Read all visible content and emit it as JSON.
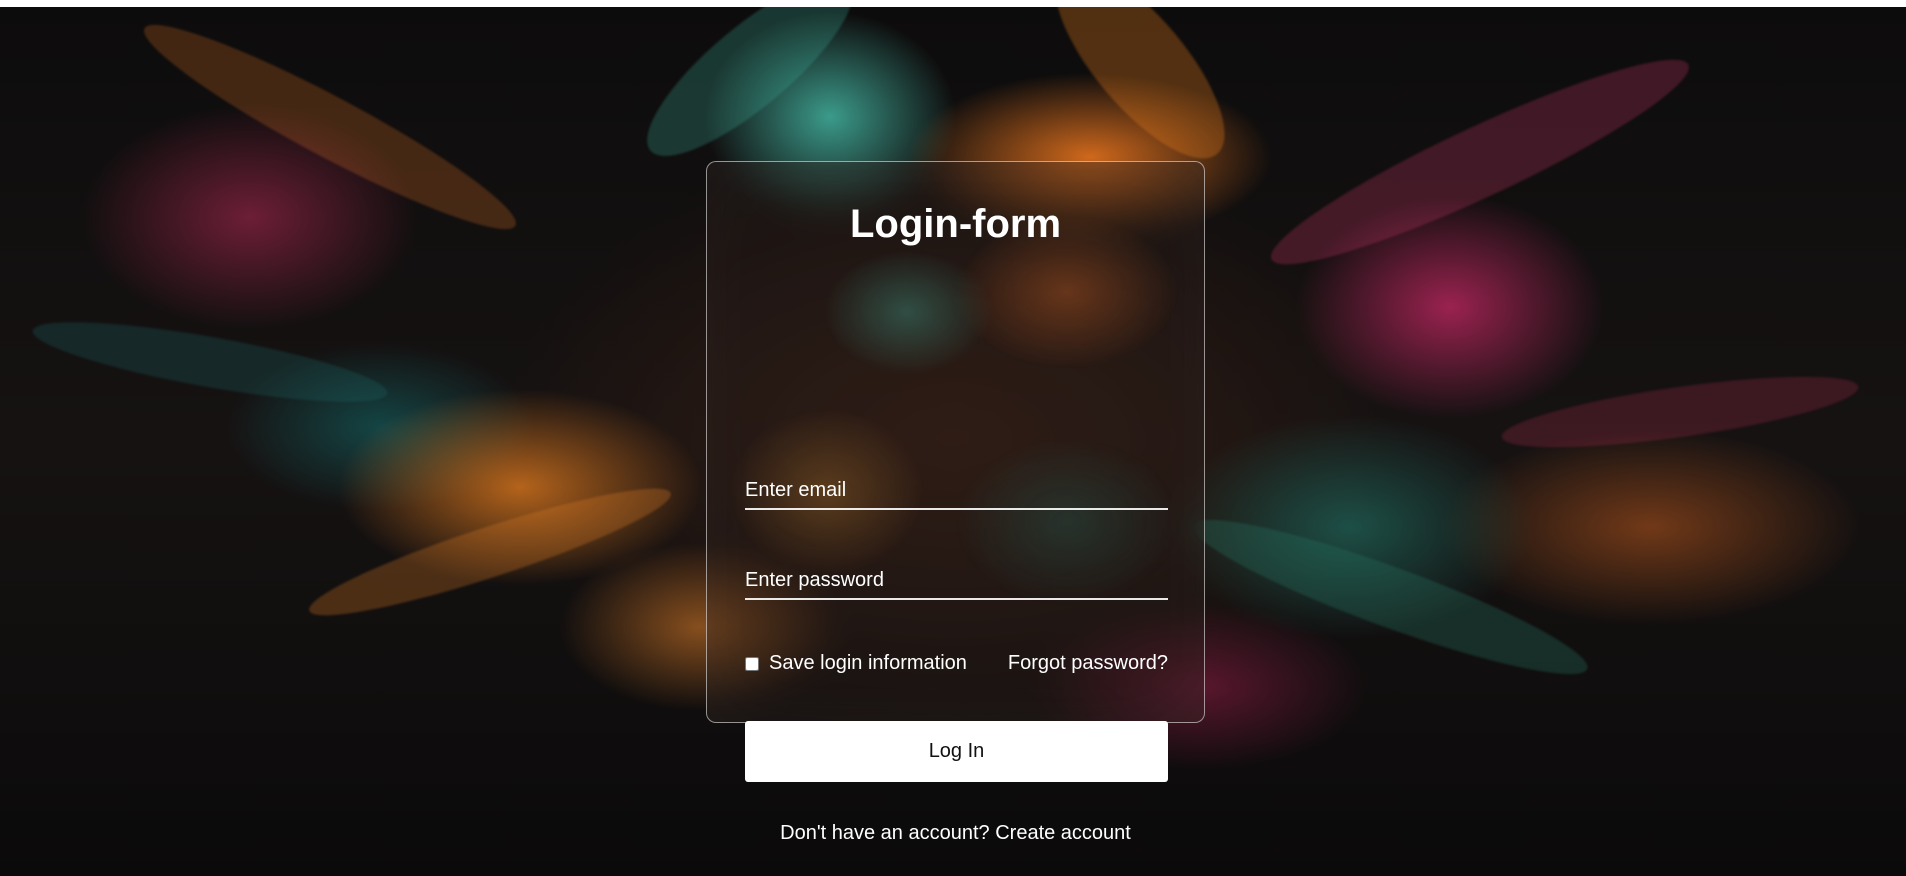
{
  "background": {
    "image_description_icon": "abstract-feathers-background"
  },
  "form": {
    "title": "Login-form",
    "email": {
      "placeholder": "Enter email",
      "value": ""
    },
    "password": {
      "placeholder": "Enter password",
      "value": ""
    },
    "remember_label": "Save login information",
    "remember_checked": false,
    "forgot_label": "Forgot password?",
    "submit_label": "Log In",
    "register_prompt": "Don't have an account?",
    "register_link": "Create account"
  },
  "colors": {
    "text": "#ffffff",
    "button_bg": "#ffffff",
    "button_text": "#111111",
    "card_border": "#cfcfcf"
  }
}
